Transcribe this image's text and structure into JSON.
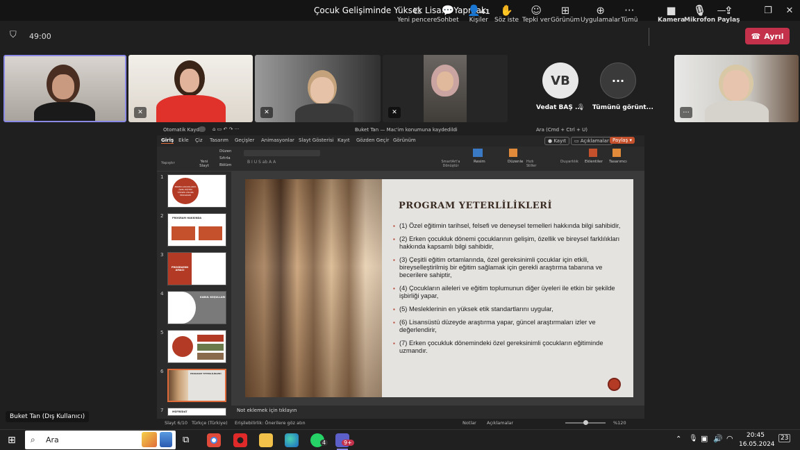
{
  "window": {
    "title": "Çocuk Gelişiminde Yüksek Lisans Yapmak"
  },
  "meeting": {
    "timer": "49:00"
  },
  "toolbar": {
    "new_window": "Yeni pencere",
    "chat": "Sohbet",
    "people": "Kişiler",
    "people_count": "41",
    "raise_hand": "Söz iste",
    "react": "Tepki ver",
    "view": "Görünüm",
    "apps": "Uygulamalar",
    "more": "Tümü",
    "camera": "Kamera",
    "mic": "Mikrofon",
    "share": "Paylaş",
    "leave": "Ayrıl"
  },
  "participants": {
    "vb_initials": "VB",
    "vb_name": "Vedat BAŞ ...",
    "view_all": "Tümünü görünt...",
    "presenter_label": "Buket Tan (Dış Kullanıcı)"
  },
  "ppt": {
    "autosave": "Otomatik Kaydet",
    "doc_title": "Buket Tan — Mac'im konumuna kaydedildi",
    "search": "Ara (Cmd + Ctrl + U)",
    "tabs": [
      "Giriş",
      "Ekle",
      "Çiz",
      "Tasarım",
      "Geçişler",
      "Animasyonlar",
      "Slayt Gösterisi",
      "Kayıt",
      "Gözden Geçir",
      "Görünüm"
    ],
    "record_btn": "Kayıt",
    "comments_btn": "Açıklamalar",
    "share_btn": "Paylaş",
    "ribbon": {
      "paste": "Yapıştır",
      "new_slide": "Yeni Slayt",
      "layout": "Düzen",
      "reset": "Sıfırla",
      "section": "Bölüm",
      "smartart": "SmartArt'a Dönüştür",
      "picture": "Resim",
      "arrange": "Düzenle",
      "quick_styles": "Hızlı Stiller",
      "sensitivity": "Duyarlılık",
      "addins": "Eklentiler",
      "designer": "Tasarımcı"
    },
    "thumb_labels": [
      "ERKEN ÇOCUKLUKTA ÖZEL EĞİTİM YÜKSEK LİSANS PROGRAMI",
      "PROGRAM HAKKINDA",
      "PROGRAMIN AMACI",
      "KABUL KOŞULLARI",
      "",
      "PROGRAM YETERLİLİKLERİ",
      "MÜFREDAT"
    ],
    "slide": {
      "title": "PROGRAM YETERLİLİKLERİ",
      "bullets": [
        "(1) Özel eğitimin tarihsel, felsefi ve deneysel temelleri hakkında bilgi sahibidir,",
        "(2) Erken çocukluk dönemi çocuklarının gelişim, özellik ve bireysel farklılıkları hakkında kapsamlı bilgi sahibidir,",
        "(3) Çeşitli eğitim ortamlarında, özel gereksinimli çocuklar için etkili, bireyselleştirilmiş bir eğitim sağlamak için gerekli araştırma tabanına ve becerilere sahiptir,",
        "(4) Çocukların aileleri ve eğitim toplumunun diğer üyeleri ile etkin bir şekilde işbirliği yapar,",
        "(5) Mesleklerinin en yüksek etik standartlarını uygular,",
        "(6) Lisansüstü düzeyde araştırma yapar, güncel araştırmaları izler ve değerlendirir,",
        "(7) Erken çocukluk dönemindeki özel gereksinimli çocukların eğitiminde uzmandır."
      ]
    },
    "notes": "Not eklemek için tıklayın",
    "status": {
      "slide": "Slayt 6/10",
      "lang": "Türkçe (Türkiye)",
      "access": "Erişilebilirlik: Önerilere göz atın",
      "notes": "Notlar",
      "comments": "Açıklamalar",
      "zoom": "%120"
    }
  },
  "taskbar": {
    "search": "Ara",
    "time": "20:45",
    "date": "16.05.2024",
    "whatsapp_badge": "4",
    "teams_badge": "9+",
    "notif": "23"
  },
  "colors": {
    "accent_red": "#c4314b",
    "slide_red": "#b33b26"
  }
}
